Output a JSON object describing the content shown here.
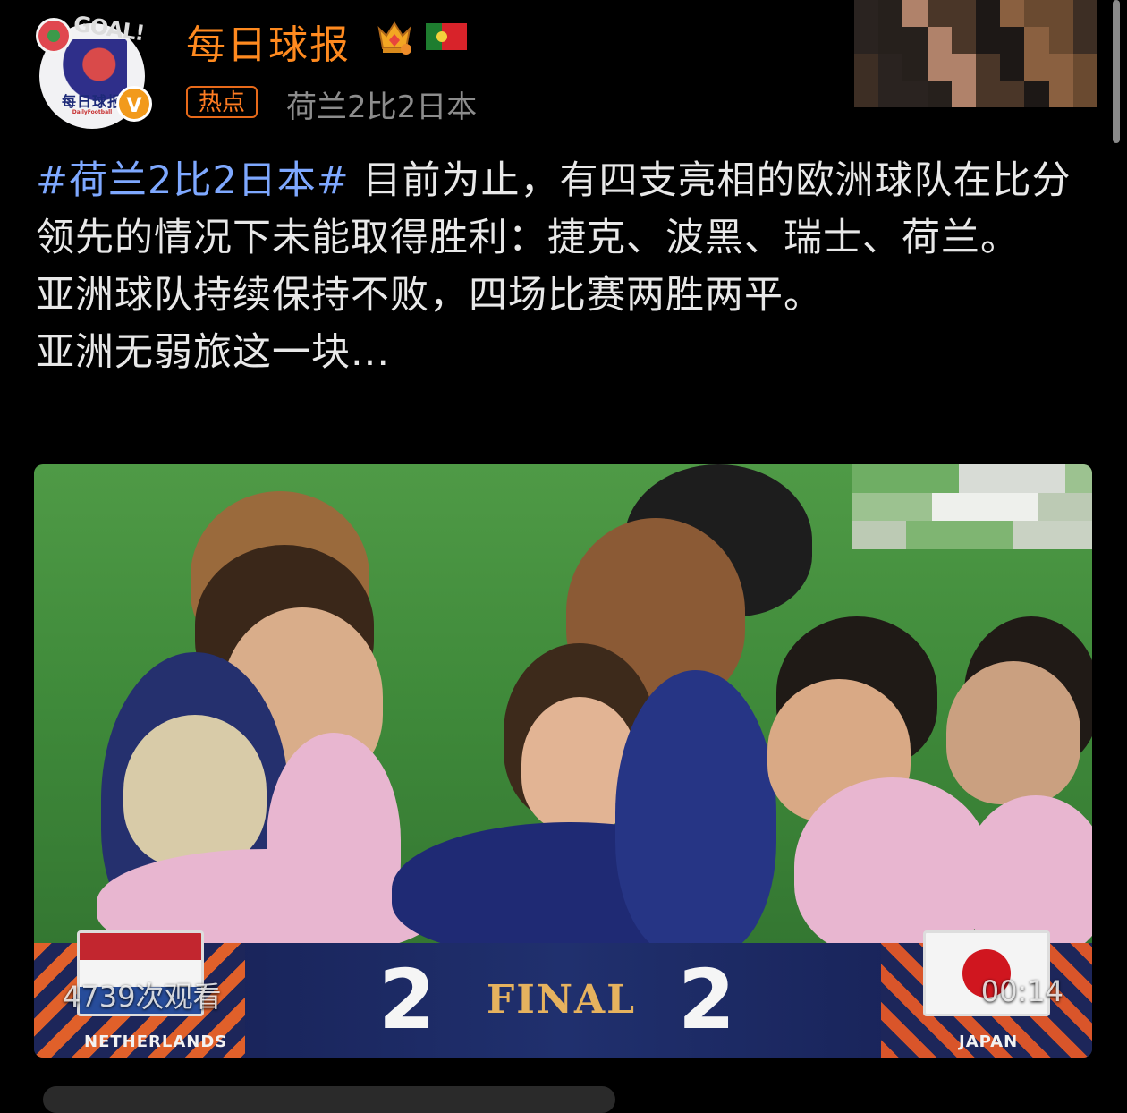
{
  "account": {
    "name": "每日球报",
    "avatar_text": "每日球报",
    "avatar_subtext": "DailyFootball",
    "avatar_logo_text": "GOAL!",
    "verified_mark": "V"
  },
  "topic": {
    "badge": "热点",
    "title": "荷兰2比2日本"
  },
  "post": {
    "hashtag": "#荷兰2比2日本#",
    "line1_rest": " 目前为止，有四支亮相的欧洲球队在比分领先的情况下未能取得胜利：捷克、波黑、瑞士、荷兰。",
    "line2": "亚洲球队持续保持不败，四场比赛两胜两平。",
    "line3": "亚洲无弱旅这一块..."
  },
  "video": {
    "view_count": "4739次观看",
    "duration": "00:14",
    "score_home": "2",
    "score_away": "2",
    "status": "FINAL",
    "team_home": "NETHERLANDS",
    "team_away": "JAPAN"
  },
  "colors": {
    "accent_orange": "#ff8a1f",
    "hashtag_blue": "#7ea8ff",
    "text_gray": "#8c8c8c"
  },
  "icons": [
    "crown-badge-icon",
    "portugal-flag-icon",
    "verified-v-icon"
  ]
}
